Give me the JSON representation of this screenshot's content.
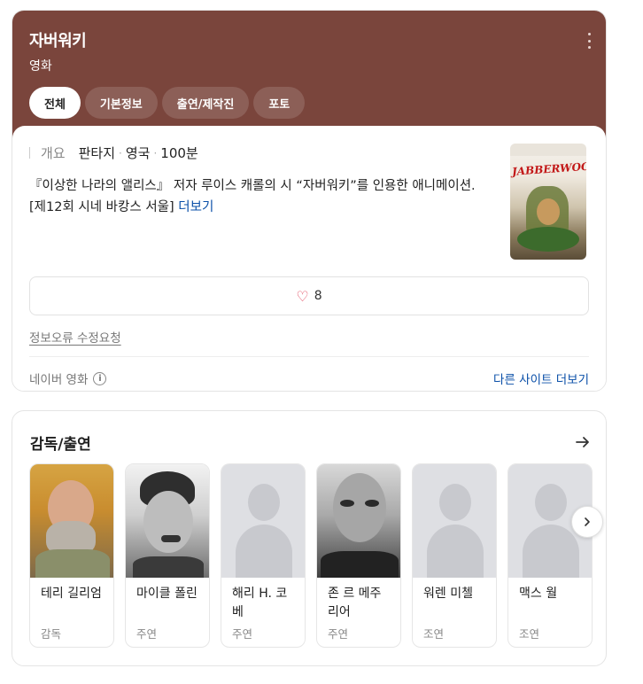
{
  "header": {
    "title": "자버워키",
    "subtitle": "영화",
    "tabs": [
      {
        "label": "전체",
        "active": true
      },
      {
        "label": "기본정보",
        "active": false
      },
      {
        "label": "출연/제작진",
        "active": false
      },
      {
        "label": "포토",
        "active": false
      }
    ],
    "bg_color": "#7a453c"
  },
  "overview": {
    "label": "개요",
    "genre": "판타지",
    "country": "영국",
    "runtime": "100분",
    "separator": "·",
    "description": "『이상한 나라의 앨리스』 저자 루이스 캐롤의 시 “자버워키”를 인용한 애니메이션. [제12회 시네 바캉스 서울]",
    "more_label": "더보기",
    "poster_wordmark": "JABBERWOCKY"
  },
  "like": {
    "count": "8",
    "icon": "heart-icon"
  },
  "report_label": "정보오류 수정요청",
  "footer": {
    "source": "네이버 영화",
    "other_sites": "다른 사이트 더보기"
  },
  "cast": {
    "title": "감독/출연",
    "people": [
      {
        "name": "테리 길리엄",
        "role": "감독",
        "photo": "real"
      },
      {
        "name": "마이클 폴린",
        "role": "주연",
        "photo": "real"
      },
      {
        "name": "해리 H. 코베",
        "role": "주연",
        "photo": "placeholder"
      },
      {
        "name": "존 르 메주리어",
        "role": "주연",
        "photo": "real"
      },
      {
        "name": "워렌 미첼",
        "role": "조연",
        "photo": "placeholder"
      },
      {
        "name": "맥스 월",
        "role": "조연",
        "photo": "placeholder"
      }
    ]
  },
  "colors": {
    "link": "#0a4fa8",
    "heart": "#e0455a"
  }
}
